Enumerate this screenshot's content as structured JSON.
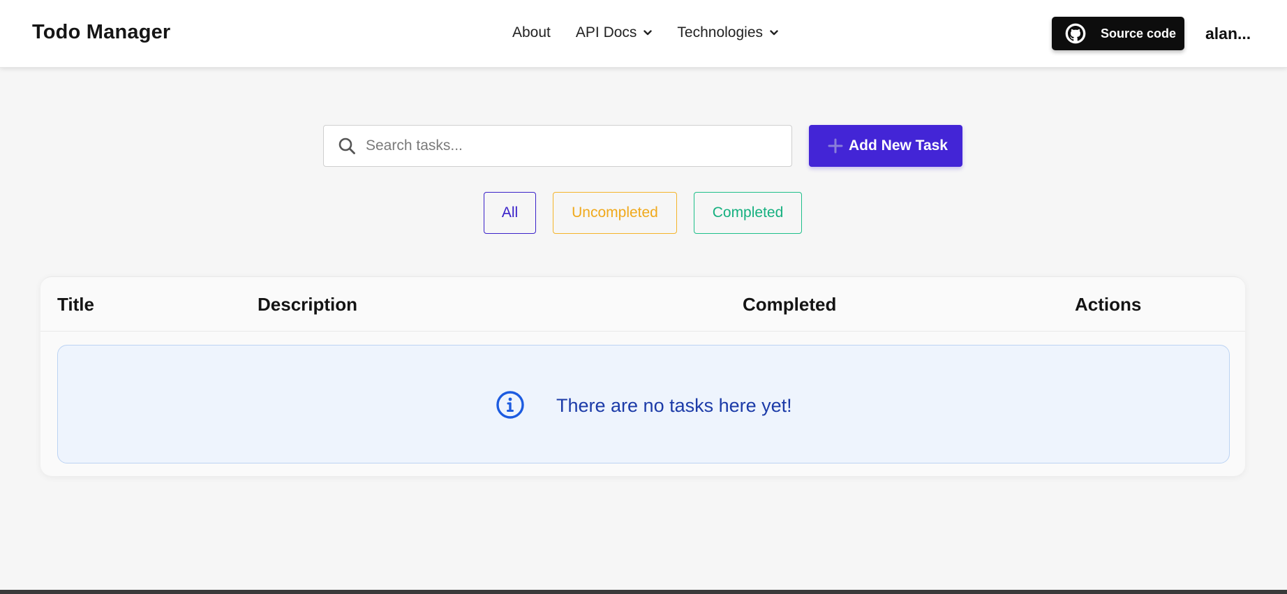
{
  "header": {
    "brand": "Todo Manager",
    "nav": [
      {
        "label": "About",
        "dropdown": false
      },
      {
        "label": "API Docs",
        "dropdown": true
      },
      {
        "label": "Technologies",
        "dropdown": true
      }
    ],
    "source_button": "Source code",
    "user": "alan..."
  },
  "toolbar": {
    "search_placeholder": "Search tasks...",
    "search_value": "",
    "add_button": "Add New Task"
  },
  "filters": [
    {
      "label": "All",
      "color": "#3a22c9"
    },
    {
      "label": "Uncompleted",
      "color": "#f0a91c"
    },
    {
      "label": "Completed",
      "color": "#15b07f"
    }
  ],
  "table": {
    "columns": [
      "Title",
      "Description",
      "Completed",
      "Actions"
    ],
    "rows": [],
    "empty_message": "There are no tasks here yet!"
  },
  "colors": {
    "accent": "#4325d6",
    "info": "#1c5be0",
    "info_bg": "#eef4fd"
  }
}
